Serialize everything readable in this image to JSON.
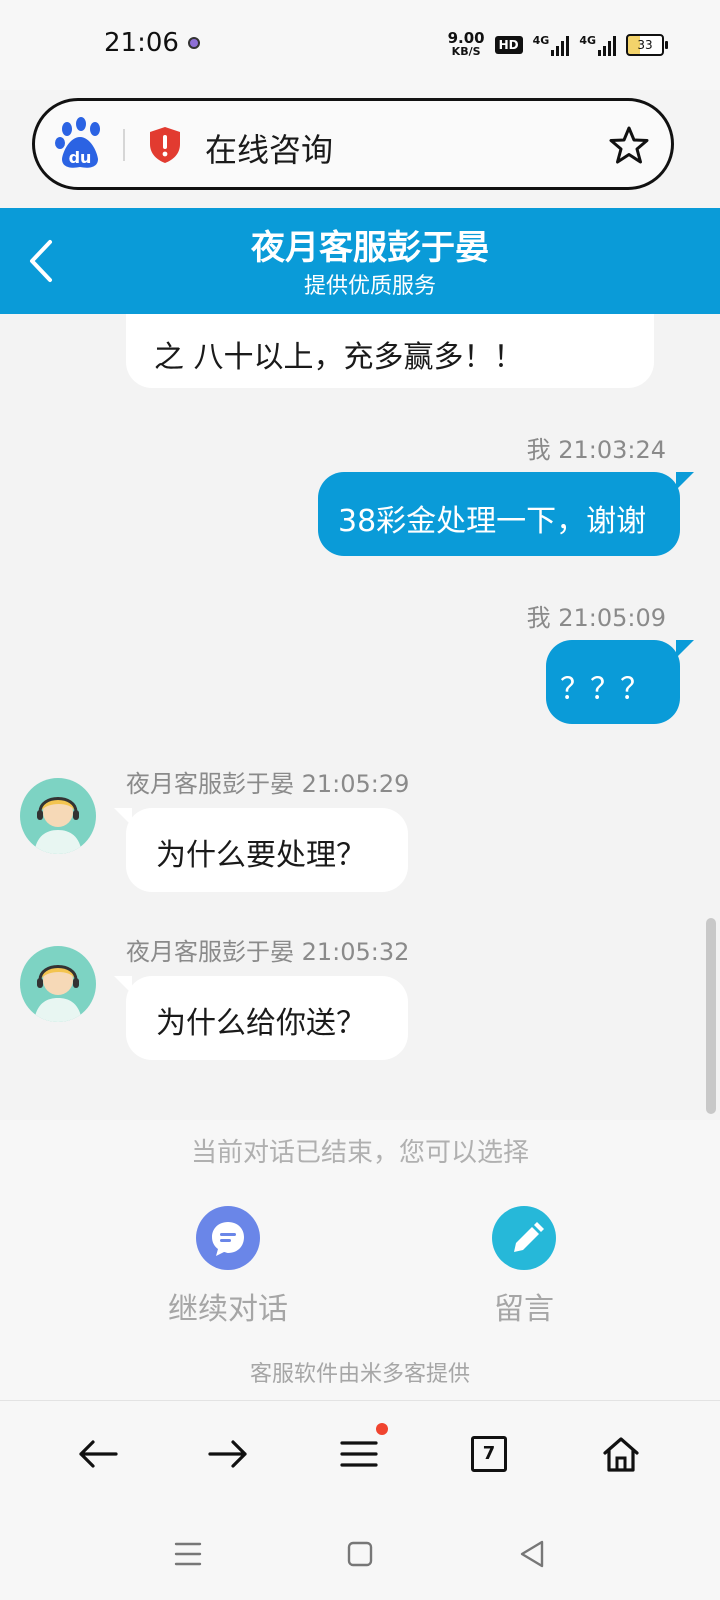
{
  "status_bar": {
    "time": "21:06",
    "speed_value": "9.00",
    "speed_unit": "KB/S",
    "hd": "HD",
    "network1": "4G",
    "network2": "4G",
    "battery": "33"
  },
  "url_bar": {
    "title": "在线咨询"
  },
  "chat_header": {
    "title": "夜月客服彭于晏",
    "subtitle": "提供优质服务"
  },
  "messages": [
    {
      "side": "agent",
      "text": "之 八十以上，充多赢多！！"
    },
    {
      "side": "me",
      "meta": "我 21:03:24",
      "text": "38彩金处理一下，谢谢"
    },
    {
      "side": "me",
      "meta": "我 21:05:09",
      "text": "？？？"
    },
    {
      "side": "agent",
      "meta": "夜月客服彭于晏 21:05:29",
      "text": "为什么要处理？"
    },
    {
      "side": "agent",
      "meta": "夜月客服彭于晏 21:05:32",
      "text": "为什么给你送？"
    }
  ],
  "ended_panel": {
    "notice": "当前对话已结束，您可以选择",
    "continue_label": "继续对话",
    "leave_message_label": "留言",
    "powered_by": "客服软件由米多客提供",
    "continue_color": "#6a86e8",
    "leave_message_color": "#26b8d9"
  },
  "browser_nav": {
    "tab_count": "7"
  },
  "colors": {
    "accent": "#0a9bd8"
  }
}
